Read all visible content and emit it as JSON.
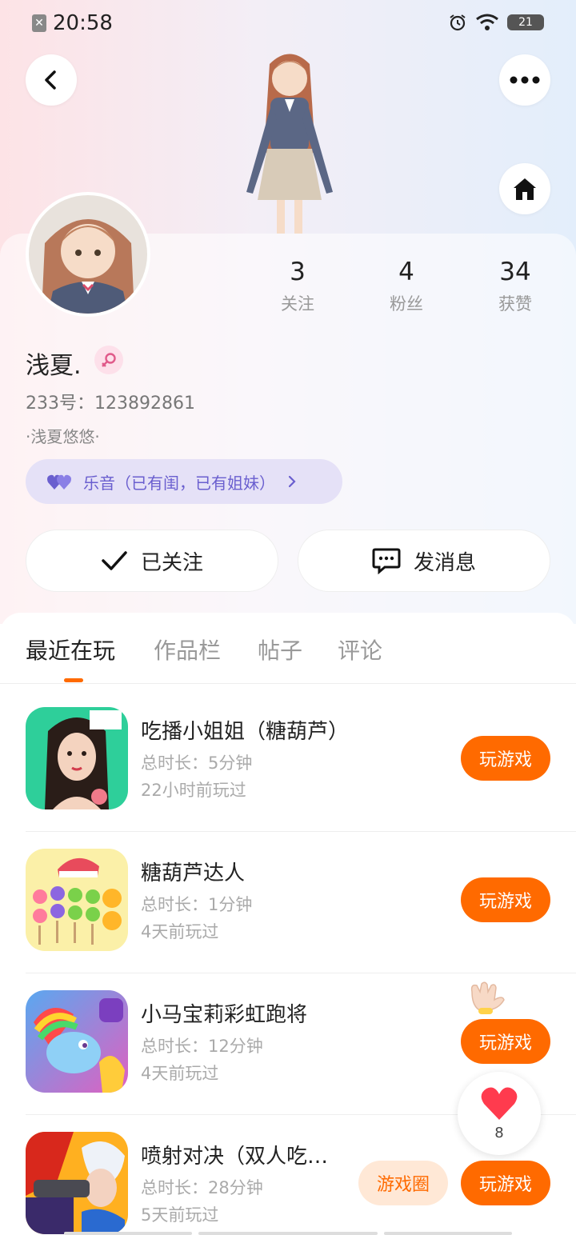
{
  "status_bar": {
    "time": "20:58",
    "battery": "21"
  },
  "profile": {
    "name": "浅夏.",
    "id_line": "233号：123892861",
    "signature": "·浅夏悠悠·",
    "tag": "乐音（已有闺，已有姐妹）",
    "stats": [
      {
        "value": "3",
        "label": "关注"
      },
      {
        "value": "4",
        "label": "粉丝"
      },
      {
        "value": "34",
        "label": "获赞"
      }
    ],
    "follow_label": "已关注",
    "message_label": "发消息"
  },
  "tabs": [
    "最近在玩",
    "作品栏",
    "帖子",
    "评论"
  ],
  "games": [
    {
      "title": "吃播小姐姐（糖葫芦）",
      "duration": "总时长：5分钟",
      "last_played": "22小时前玩过",
      "play_label": "玩游戏"
    },
    {
      "title": "糖葫芦达人",
      "duration": "总时长：1分钟",
      "last_played": "4天前玩过",
      "play_label": "玩游戏"
    },
    {
      "title": "小马宝莉彩虹跑将",
      "duration": "总时长：12分钟",
      "last_played": "4天前玩过",
      "play_label": "玩游戏"
    },
    {
      "title": "喷射对决（双人吃…",
      "duration": "总时长：28分钟",
      "last_played": "5天前玩过",
      "play_label": "玩游戏",
      "circle_label": "游戏圈"
    }
  ],
  "like_count": "8",
  "colors": {
    "accent": "#ff6a00",
    "tag_text": "#6a5fcf",
    "tag_bg": "#e5e1f7"
  }
}
